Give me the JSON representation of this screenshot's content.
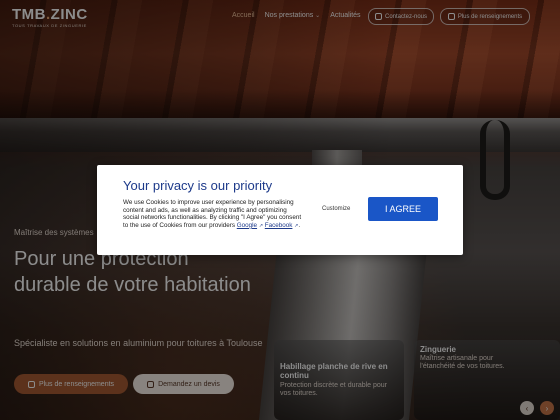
{
  "header": {
    "logo_main": "TMB",
    "logo_dot": ".",
    "logo_zinc": "ZINC",
    "logo_tagline": "TOUS TRAVAUX DE ZINGUERIE",
    "nav": [
      {
        "label": "Accueil",
        "active": true
      },
      {
        "label": "Nos prestations",
        "has_dropdown": true
      },
      {
        "label": "Actualités"
      }
    ],
    "contact_button": "Contactez-nous",
    "info_button": "Plus de renseignements"
  },
  "hero": {
    "kicker": "Maîtrise des systèmes",
    "title": "Pour une protection durable de votre habitation",
    "subtitle": "Spécialiste en solutions en aluminium pour toitures à Toulouse",
    "primary_button": "Plus de renseignements",
    "secondary_button": "Demandez un devis"
  },
  "cards": [
    {
      "title": "Habillage planche de rive en continu",
      "text": "Protection discrète et durable pour vos toitures."
    },
    {
      "title": "Zinguerie",
      "text": "Maîtrise artisanale pour l'étanchéité de vos toitures."
    }
  ],
  "carousel": {
    "prev_icon": "chevron-left-icon",
    "next_icon": "chevron-right-icon"
  },
  "cookie_modal": {
    "title": "Your privacy is our priority",
    "body_text": "We use Cookies to improve user experience by personalising content and ads, as well as analyzing traffic and optimizing social networks functionalities. By clicking \"I Agree\" you consent to the use of Cookies from our providers",
    "link_google": "Google",
    "link_facebook": "Facebook",
    "customize_label": "Customize",
    "agree_label": "I AGREE"
  },
  "colors": {
    "accent": "#a85c33",
    "modal_title": "#1d3a8a",
    "agree_button": "#1a56c7"
  }
}
